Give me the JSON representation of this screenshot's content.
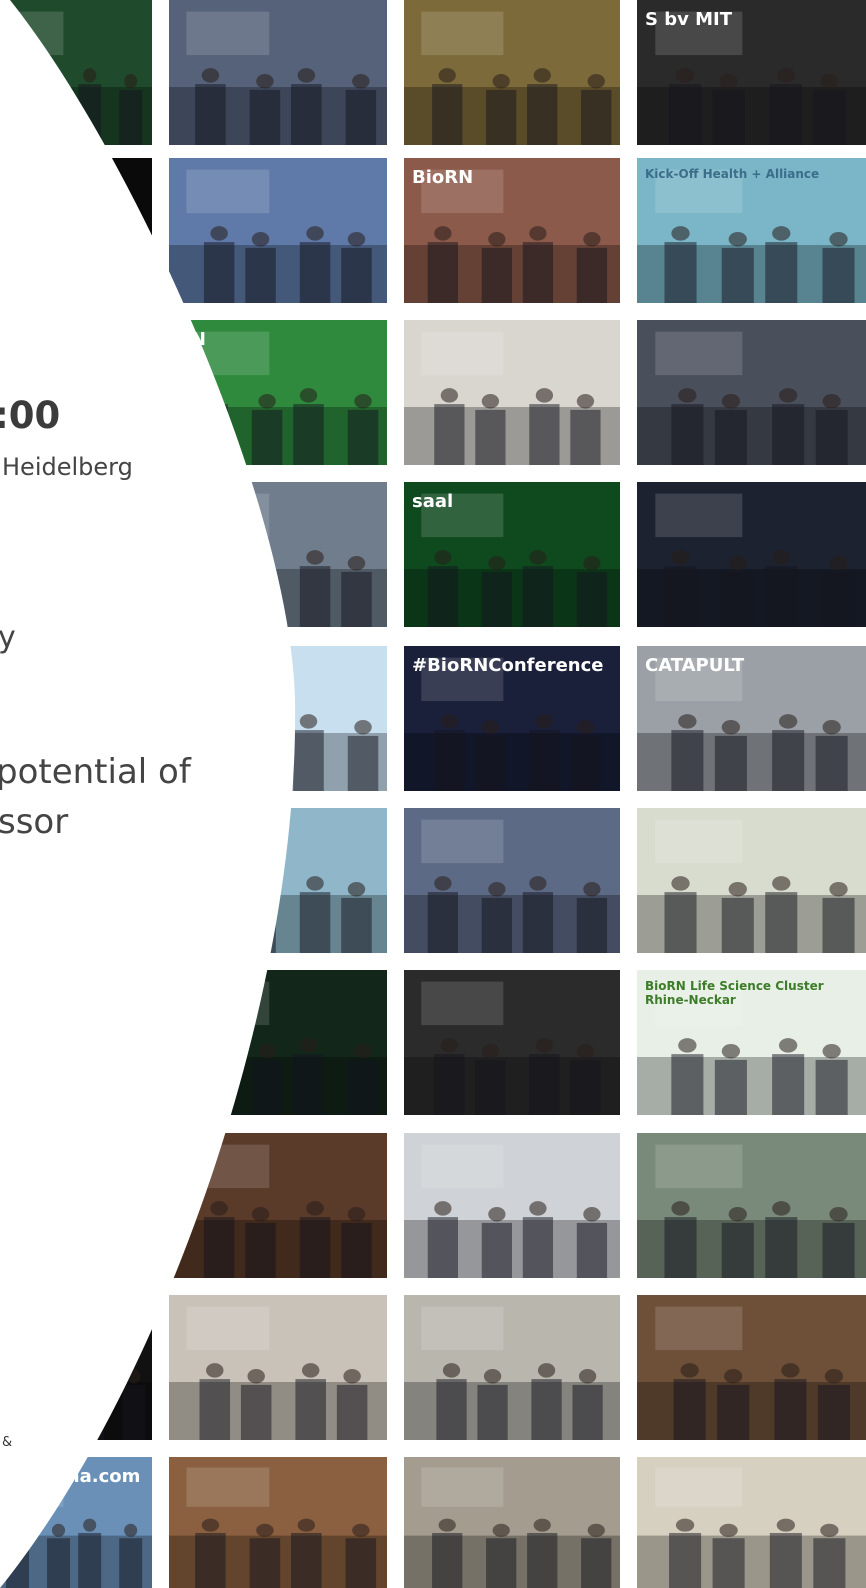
{
  "event": {
    "time_fragment": ":00",
    "location_fragment": "Heidelberg",
    "char_fragment": "y",
    "desc_line1": "potential of",
    "desc_line2": "ssor",
    "amp": "&"
  },
  "photos": [
    {
      "id": "r1c1",
      "desc": "green-lit exhibition hall",
      "color": "#1f4a2c",
      "overlay": ""
    },
    {
      "id": "r1c2",
      "desc": "meeting room with window",
      "color": "#55627a",
      "overlay": ""
    },
    {
      "id": "r1c3",
      "desc": "outdoor terrace autumn",
      "color": "#7d6a3a",
      "overlay": ""
    },
    {
      "id": "r1c4",
      "desc": "selfie at summit sign",
      "color": "#2a2a2a",
      "overlay": "S  bv  MIT"
    },
    {
      "id": "r2c1",
      "desc": "dark curve",
      "color": "#0a0a0a",
      "overlay": ""
    },
    {
      "id": "r2c2",
      "desc": "crowd outdoors",
      "color": "#5f7aa8",
      "overlay": ""
    },
    {
      "id": "r2c3",
      "desc": "group jumping at BioRN banner",
      "color": "#8c5a4a",
      "overlay": "BioRN"
    },
    {
      "id": "r2c4",
      "desc": "kick-off speaker",
      "color": "#7ab6c8",
      "overlay": "Kick-Off Health + Alliance"
    },
    {
      "id": "r3c2",
      "desc": "green BioRN logo object",
      "color": "#2f8a3e",
      "overlay": "RN"
    },
    {
      "id": "r3c3",
      "desc": "speaker in red skirt",
      "color": "#d9d6d0",
      "overlay": ""
    },
    {
      "id": "r3c4",
      "desc": "two men shaking hands",
      "color": "#4a4f5c",
      "overlay": ""
    },
    {
      "id": "r4c2",
      "desc": "building facade crowd",
      "color": "#6f7d8c",
      "overlay": ""
    },
    {
      "id": "r4c3",
      "desc": "green lit saal entrance",
      "color": "#0f4a1f",
      "overlay": "saal"
    },
    {
      "id": "r4c4",
      "desc": "three people on stage",
      "color": "#1c2230",
      "overlay": ""
    },
    {
      "id": "r5c2",
      "desc": "molecule poster",
      "color": "#c8dff0",
      "overlay": ""
    },
    {
      "id": "r5c3",
      "desc": "conference stage",
      "color": "#1a1f3a",
      "overlay": "#BioRNConference"
    },
    {
      "id": "r5c4",
      "desc": "group at catapult banner",
      "color": "#9aa0a6",
      "overlay": "CATAPULT"
    },
    {
      "id": "r6c2",
      "desc": "two men at booth",
      "color": "#8fb7c9",
      "overlay": ""
    },
    {
      "id": "r6c3",
      "desc": "audience in hall",
      "color": "#5d6a86",
      "overlay": ""
    },
    {
      "id": "r6c4",
      "desc": "exhibition booth",
      "color": "#d8dccf",
      "overlay": ""
    },
    {
      "id": "r7c2",
      "desc": "dark audience",
      "color": "#12261a",
      "overlay": ""
    },
    {
      "id": "r7c3",
      "desc": "elderly speaker",
      "color": "#2b2b2b",
      "overlay": ""
    },
    {
      "id": "r7c4",
      "desc": "speaker at BioRN banner",
      "color": "#e7efe6",
      "overlay": "BioRN  Life Science Cluster Rhine-Neckar"
    },
    {
      "id": "r8c2",
      "desc": "dinner hall chandeliers",
      "color": "#5a3a28",
      "overlay": ""
    },
    {
      "id": "r8c3",
      "desc": "panel discussion",
      "color": "#cfd2d6",
      "overlay": ""
    },
    {
      "id": "r8c4",
      "desc": "three people selfie",
      "color": "#7a8a7a",
      "overlay": ""
    },
    {
      "id": "r9c1",
      "desc": "dark corner",
      "color": "#111111",
      "overlay": ""
    },
    {
      "id": "r9c2",
      "desc": "whiteboard workshop",
      "color": "#c9c2b8",
      "overlay": ""
    },
    {
      "id": "r9c3",
      "desc": "speaker with microphone",
      "color": "#b9b6ae",
      "overlay": ""
    },
    {
      "id": "r9c4",
      "desc": "brick hall speaker",
      "color": "#6e5038",
      "overlay": ""
    },
    {
      "id": "r10c1",
      "desc": "two people at booth",
      "color": "#6a90b8",
      "overlay": "c-pharma.com"
    },
    {
      "id": "r10c2",
      "desc": "three women selfie",
      "color": "#8a6040",
      "overlay": ""
    },
    {
      "id": "r10c3",
      "desc": "glass roof hall",
      "color": "#a49d8f",
      "overlay": ""
    },
    {
      "id": "r10c4",
      "desc": "presentation bar chart",
      "color": "#d6d0c0",
      "overlay": ""
    }
  ]
}
